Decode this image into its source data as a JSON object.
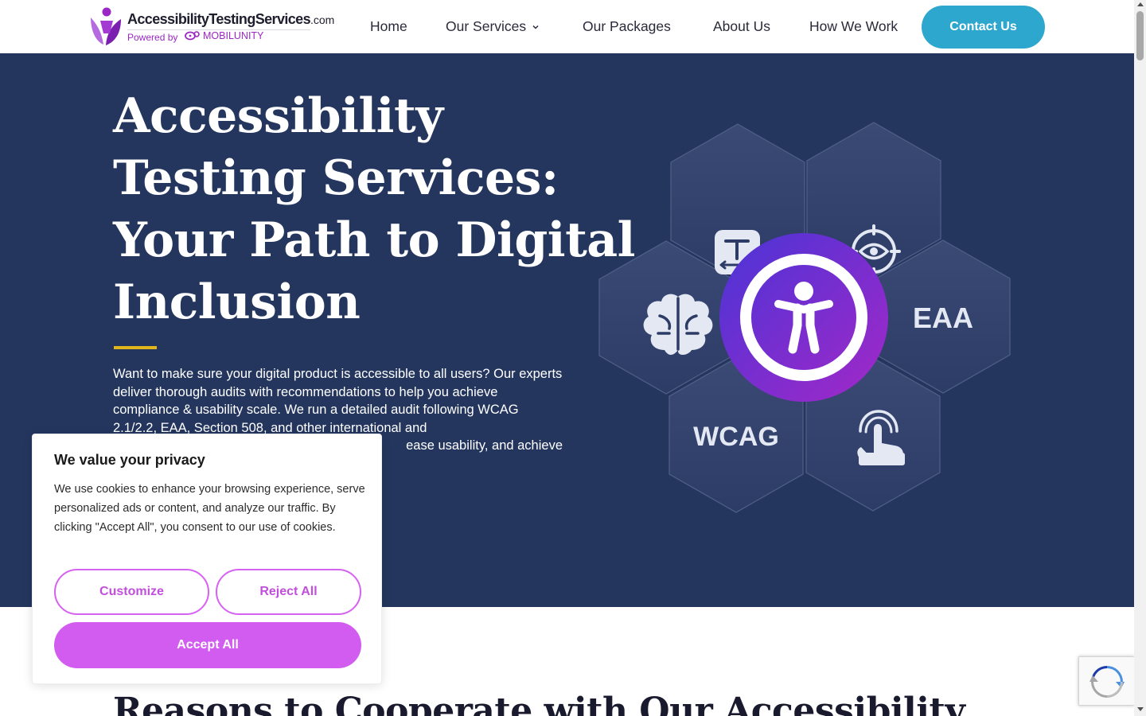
{
  "brand": {
    "title": "AccessibilityTestingServices",
    "title_suffix": ".com",
    "powered_by": "Powered by",
    "partner": "MOBILUNITY",
    "colors": {
      "primary_purple": "#9b27c6",
      "accent_blue": "#2ea7ce",
      "hero_bg": "#24365e",
      "accent_gold": "#e3b51c",
      "cookie_accent": "#d25cf0"
    }
  },
  "nav": {
    "items": [
      {
        "label": "Home"
      },
      {
        "label": "Our Services",
        "has_dropdown": true,
        "icon": "chevron-down-icon"
      },
      {
        "label": "Our Packages"
      },
      {
        "label": "About Us"
      },
      {
        "label": "How We Work"
      }
    ],
    "cta": "Contact Us"
  },
  "hero": {
    "title_lines": [
      "Accessibility",
      "Testing Services:",
      "Your Path to Digital",
      "Inclusion"
    ],
    "description": "Want to make sure your digital product is accessible to all users? Our experts deliver thorough audits with recommendations to help you achieve compliance & usability scale. We run a detailed audit following WCAG 2.1/2.2, EAA, Section 508, and other international and",
    "description_tail": "ease usability, and achieve",
    "graphic": {
      "tiles": [
        {
          "icon": "text-width-icon"
        },
        {
          "icon": "eye-target-icon"
        },
        {
          "icon": "brain-icon"
        },
        {
          "label": "EAA"
        },
        {
          "label": "WCAG"
        },
        {
          "icon": "touch-tap-icon"
        }
      ],
      "center_icon": "accessibility-person-icon"
    }
  },
  "section": {
    "title": "Reasons to Cooperate with Our Accessibility"
  },
  "cookie_banner": {
    "title": "We value your privacy",
    "text": "We use cookies to enhance your browsing experience, serve personalized ads or content, and analyze our traffic. By clicking \"Accept All\", you consent to our use of cookies.",
    "customize": "Customize",
    "reject": "Reject All",
    "accept": "Accept All"
  },
  "recaptcha": {
    "icon": "recaptcha-icon"
  }
}
